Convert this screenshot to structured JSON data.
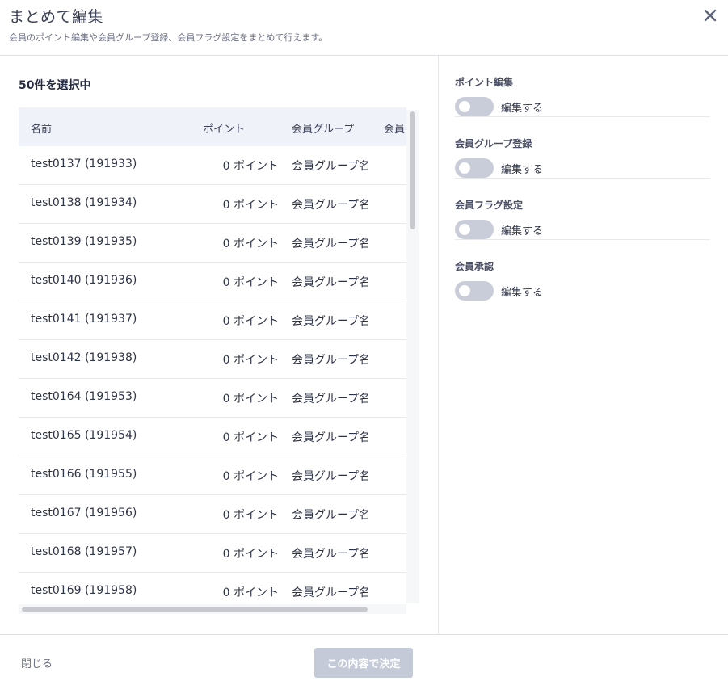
{
  "header": {
    "title": "まとめて編集",
    "subtitle": "会員のポイント編集や会員グループ登録、会員フラグ設定をまとめて行えます。",
    "close_icon": "close-icon"
  },
  "selection": {
    "count_text": "50件を選択中"
  },
  "table": {
    "columns": [
      "名前",
      "ポイント",
      "会員グループ",
      "会員フ"
    ],
    "rows": [
      {
        "name": "test0137 (191933)",
        "point": "0 ポイント",
        "group": "会員グループ名"
      },
      {
        "name": "test0138 (191934)",
        "point": "0 ポイント",
        "group": "会員グループ名"
      },
      {
        "name": "test0139 (191935)",
        "point": "0 ポイント",
        "group": "会員グループ名"
      },
      {
        "name": "test0140 (191936)",
        "point": "0 ポイント",
        "group": "会員グループ名"
      },
      {
        "name": "test0141 (191937)",
        "point": "0 ポイント",
        "group": "会員グループ名"
      },
      {
        "name": "test0142 (191938)",
        "point": "0 ポイント",
        "group": "会員グループ名"
      },
      {
        "name": "test0164 (191953)",
        "point": "0 ポイント",
        "group": "会員グループ名"
      },
      {
        "name": "test0165 (191954)",
        "point": "0 ポイント",
        "group": "会員グループ名"
      },
      {
        "name": "test0166 (191955)",
        "point": "0 ポイント",
        "group": "会員グループ名"
      },
      {
        "name": "test0167 (191956)",
        "point": "0 ポイント",
        "group": "会員グループ名"
      },
      {
        "name": "test0168 (191957)",
        "point": "0 ポイント",
        "group": "会員グループ名"
      },
      {
        "name": "test0169 (191958)",
        "point": "0 ポイント",
        "group": "会員グループ名"
      }
    ]
  },
  "settings": [
    {
      "label": "ポイント編集",
      "toggle_label": "編集する",
      "enabled": false
    },
    {
      "label": "会員グループ登録",
      "toggle_label": "編集する",
      "enabled": false
    },
    {
      "label": "会員フラグ設定",
      "toggle_label": "編集する",
      "enabled": false
    },
    {
      "label": "会員承認",
      "toggle_label": "編集する",
      "enabled": false
    }
  ],
  "footer": {
    "close_label": "閉じる",
    "confirm_label": "この内容で決定"
  },
  "colors": {
    "table_header_bg": "#eff2f9",
    "toggle_off": "#c9ccd9",
    "button_disabled": "#c5cad8"
  }
}
